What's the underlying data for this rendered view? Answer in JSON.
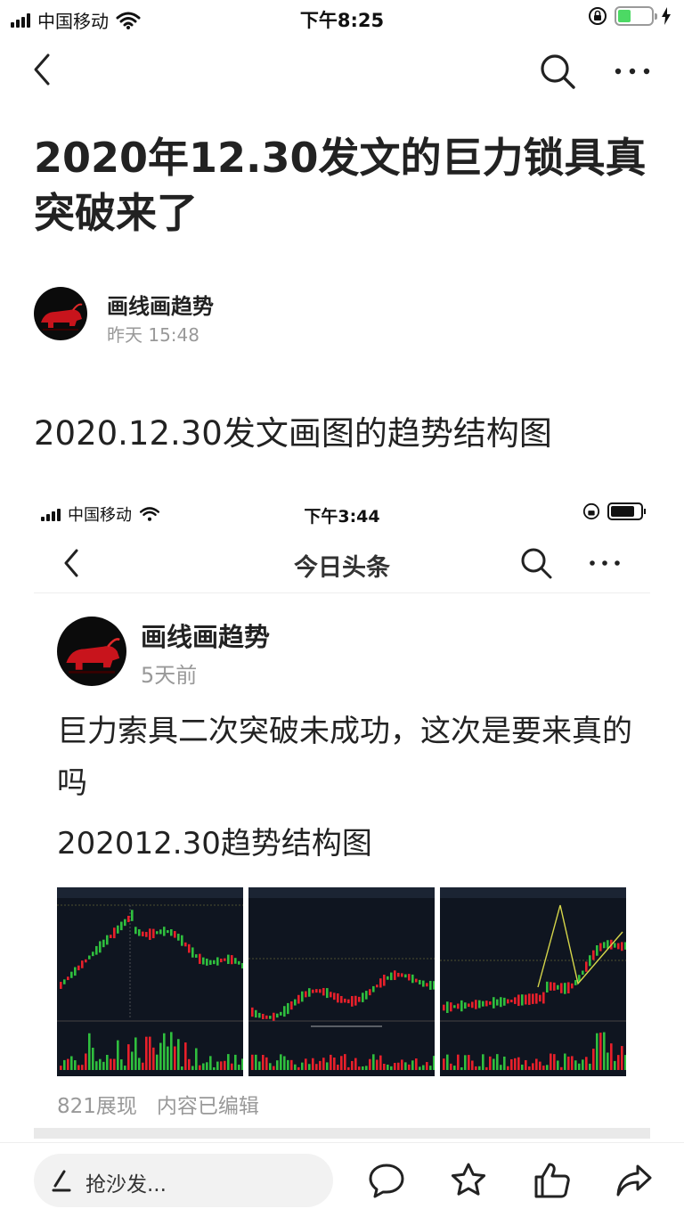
{
  "status_bar": {
    "carrier": "中国移动",
    "time": "下午8:25"
  },
  "article": {
    "title": "2020年12.30发文的巨力锁具真突破来了",
    "author": {
      "name": "画线画趋势",
      "time": "昨天 15:48"
    },
    "lead": "2020.12.30发文画图的趋势结构图"
  },
  "embedded_screenshot": {
    "status_bar": {
      "carrier": "中国移动",
      "time": "下午3:44"
    },
    "nav_title": "今日头条",
    "author": {
      "name": "画线画趋势",
      "time": "5天前"
    },
    "text_line1": "巨力索具二次突破未成功，这次是要来真的吗",
    "text_line2": "202012.30趋势结构图",
    "stats": {
      "views": "821展现",
      "edited": "内容已编辑"
    }
  },
  "bottom_bar": {
    "comment_placeholder": "抢沙发..."
  },
  "colors": {
    "up": "#e8202a",
    "down": "#2fbf3e",
    "chart_bg": "#0f1520",
    "accent_battery": "#4cd964"
  }
}
